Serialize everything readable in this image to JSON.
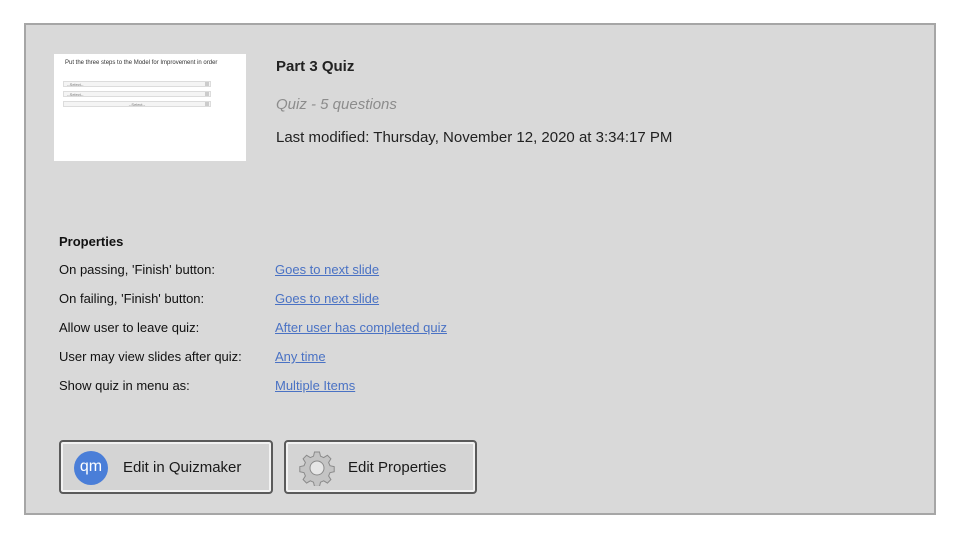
{
  "quiz": {
    "title": "Part 3 Quiz",
    "subtitle": "Quiz - 5 questions",
    "last_modified": "Last modified: Thursday, November 12, 2020 at 3:34:17 PM"
  },
  "thumbnail": {
    "question": "Put the three steps to the Model for Improvement in order",
    "select_1": "--Select--",
    "select_2": "--Select--",
    "select_3": "--Select--"
  },
  "properties": {
    "heading": "Properties",
    "rows": [
      {
        "label": "On passing, 'Finish' button:",
        "value": "Goes to next slide"
      },
      {
        "label": "On failing, 'Finish' button:",
        "value": "Goes to next slide"
      },
      {
        "label": "Allow user to leave quiz:",
        "value": "After user has completed quiz"
      },
      {
        "label": "User may view slides after quiz:",
        "value": "Any time"
      },
      {
        "label": "Show quiz in menu as:",
        "value": "Multiple Items"
      }
    ]
  },
  "buttons": {
    "edit_quizmaker": {
      "label": "Edit in Quizmaker",
      "logo_text": "qm",
      "icon": "quizmaker-logo-icon"
    },
    "edit_properties": {
      "label": "Edit Properties",
      "icon": "gear-icon"
    }
  },
  "colors": {
    "panel_bg": "#d9d9d9",
    "link": "#4a72c4",
    "qm_logo": "#4a7ed8"
  }
}
